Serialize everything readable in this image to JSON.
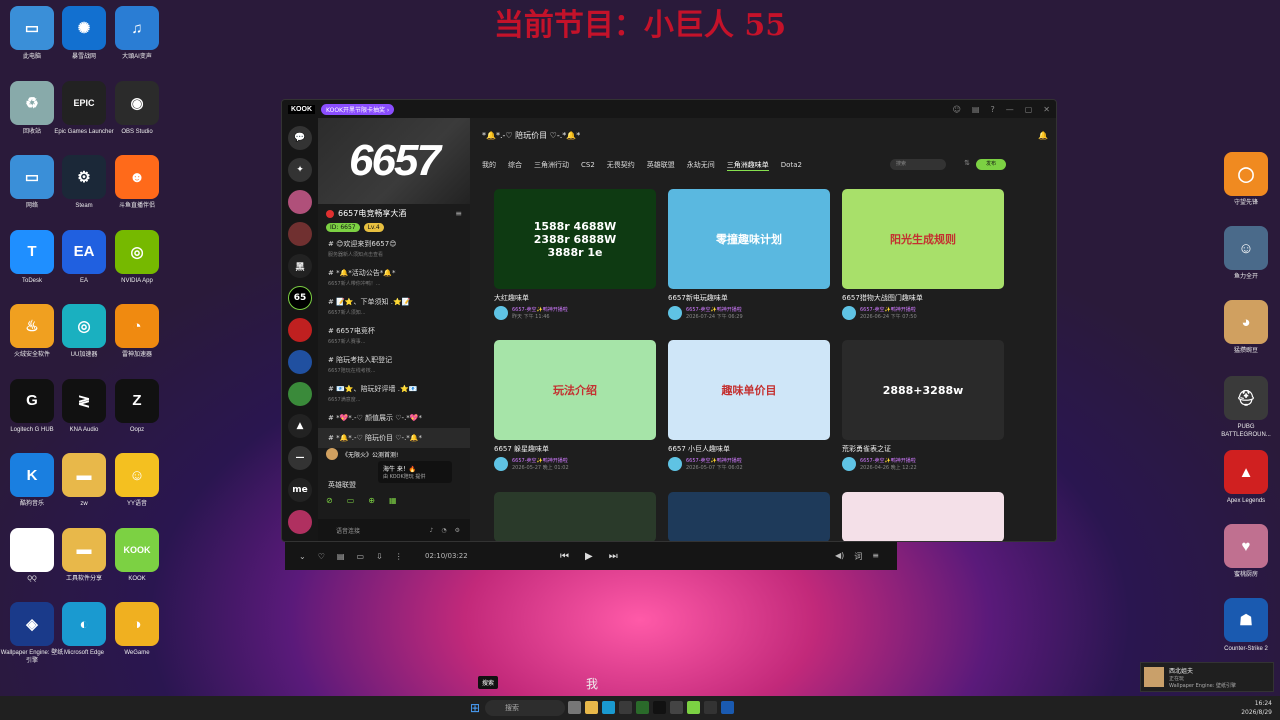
{
  "wallpaper": {
    "title": "当前节目：小巨人 55"
  },
  "desktop_left": [
    {
      "label": "此电脑",
      "icon": "monitor-icon",
      "glyph": "▭",
      "color": "#3a8fd8"
    },
    {
      "label": "暴雪战网",
      "icon": "battlenet-icon",
      "glyph": "✺",
      "color": "#1270d0"
    },
    {
      "label": "大頭AI变声",
      "icon": "voice-changer-icon",
      "glyph": "♫",
      "color": "#2a7dd4"
    },
    {
      "label": "回收站",
      "icon": "recycle-bin-icon",
      "glyph": "♻",
      "color": "#8aa"
    },
    {
      "label": "Epic Games Launcher",
      "icon": "epic-games-icon",
      "glyph": "EPIC",
      "color": "#222"
    },
    {
      "label": "OBS Studio",
      "icon": "obs-icon",
      "glyph": "◉",
      "color": "#2b2b2b"
    },
    {
      "label": "网络",
      "icon": "network-icon",
      "glyph": "▭",
      "color": "#3a8fd8"
    },
    {
      "label": "Steam",
      "icon": "steam-icon",
      "glyph": "⚙",
      "color": "#1b2838"
    },
    {
      "label": "斗鱼直播伴侣",
      "icon": "douyu-icon",
      "glyph": "☻",
      "color": "#ff6a1a"
    },
    {
      "label": "ToDesk",
      "icon": "todesk-icon",
      "glyph": "T",
      "color": "#1f8fff"
    },
    {
      "label": "EA",
      "icon": "ea-icon",
      "glyph": "EA",
      "color": "#2060e0"
    },
    {
      "label": "NVIDIA App",
      "icon": "nvidia-icon",
      "glyph": "◎",
      "color": "#76b900"
    },
    {
      "label": "火绒安全软件",
      "icon": "huorong-icon",
      "glyph": "♨",
      "color": "#f0a020"
    },
    {
      "label": "UU加速器",
      "icon": "uu-icon",
      "glyph": "◎",
      "color": "#1ab0c0"
    },
    {
      "label": "雷神加速器",
      "icon": "leishen-icon",
      "glyph": "◔",
      "color": "#f08a10"
    },
    {
      "label": "Logitech G HUB",
      "icon": "logitech-icon",
      "glyph": "G",
      "color": "#111"
    },
    {
      "label": "KNA Audio",
      "icon": "kna-icon",
      "glyph": "≷",
      "color": "#111"
    },
    {
      "label": "Oopz",
      "icon": "oopz-icon",
      "glyph": "Z",
      "color": "#111"
    },
    {
      "label": "酷狗音乐",
      "icon": "kugou-icon",
      "glyph": "K",
      "color": "#1a7fe0"
    },
    {
      "label": "zw",
      "icon": "folder-icon",
      "glyph": "▬",
      "color": "#e8b84a"
    },
    {
      "label": "YY语音",
      "icon": "yy-icon",
      "glyph": "☺",
      "color": "#f4c020"
    },
    {
      "label": "QQ",
      "icon": "qq-icon",
      "glyph": "☃",
      "color": "#fff"
    },
    {
      "label": "工具软件分享",
      "icon": "folder-icon",
      "glyph": "▬",
      "color": "#e8b84a"
    },
    {
      "label": "KOOK",
      "icon": "kook-icon",
      "glyph": "KOOK",
      "color": "#7cd143"
    },
    {
      "label": "Wallpaper Engine: 壁纸引擎",
      "icon": "wallpaper-engine-icon",
      "glyph": "◈",
      "color": "#1a3a8a"
    },
    {
      "label": "Microsoft Edge",
      "icon": "edge-icon",
      "glyph": "◐",
      "color": "#1a9ad0"
    },
    {
      "label": "WeGame",
      "icon": "wegame-icon",
      "glyph": "◑",
      "color": "#f0b020"
    }
  ],
  "desktop_right": [
    {
      "label": "守望先锋",
      "icon": "overwatch-icon",
      "glyph": "◯",
      "color": "#f08a20"
    },
    {
      "label": "鱼力全开",
      "icon": "game-icon",
      "glyph": "☺",
      "color": "#4a6a8a"
    },
    {
      "label": "猛攒豌豆",
      "icon": "game-icon",
      "glyph": "◕",
      "color": "#d0a060"
    },
    {
      "label": "PUBG BATTLEGROUN...",
      "icon": "pubg-icon",
      "glyph": "⛑",
      "color": "#3a3a3a"
    },
    {
      "label": "Apex Legends",
      "icon": "apex-icon",
      "glyph": "▲",
      "color": "#d02020"
    },
    {
      "label": "蜜桃厨房",
      "icon": "game-icon",
      "glyph": "♥",
      "color": "#c07090"
    },
    {
      "label": "Counter-Strike 2",
      "icon": "cs2-icon",
      "glyph": "☗",
      "color": "#1a5ab0"
    }
  ],
  "kook": {
    "logo": "KOOK",
    "badge": "KOOK开黑节限卡抽奖 ›",
    "server_banner": "6657",
    "server_name": "6657电竞畅享大酒",
    "tags": [
      "ID: 6657",
      "Lv.4"
    ],
    "channels": [
      {
        "name": "😊欢迎来到6657😊",
        "desc": "服务器新人须知点击查看"
      },
      {
        "name": "*🔔*活动公告*🔔*",
        "desc": "6657新人带你冲鸭！..."
      },
      {
        "name": "📝⭐、下单须知 .⭐📝",
        "desc": "6657新人须知..."
      },
      {
        "name": "6657电竞杯",
        "desc": "6657新人赛事..."
      },
      {
        "name": "陪玩考核入职登记",
        "desc": "6657陪玩在线考核..."
      },
      {
        "name": "📧⭐、陪玩好评墙 .⭐📧",
        "desc": "6657满意度..."
      },
      {
        "name": "*💖*.-♡ 颜值展示 ♡-.*💖*",
        "desc": ""
      },
      {
        "name": "*🔔*.-♡ 陪玩价目 ♡-.*🔔*",
        "desc": ""
      }
    ],
    "voice_user": "《无限火》公测首测!",
    "voice_channel": "英雄联盟",
    "sidebar_bottom": "语音连接",
    "channel_title": "*🔔*.-♡ 陪玩价目 ♡-.*🔔*",
    "tabs": [
      "我的",
      "综合",
      "三角洲行动",
      "CS2",
      "无畏契约",
      "英雄联盟",
      "永劫无间",
      "三角洲趣味单",
      "Dota2"
    ],
    "active_tab": "三角洲趣味单",
    "search_placeholder": "搜索",
    "new_button": "发布",
    "cards": [
      {
        "title": "大红趣味单",
        "author": "6657-卖空✨鸭神开播啦",
        "date": "昨天 下午 11:46",
        "thumb": "1588r 4688W\n2388r 6888W\n3888r 1e",
        "bg": "#0e3a12"
      },
      {
        "title": "6657新电玩趣味单",
        "author": "6657-卖空✨鸭神开播啦",
        "date": "2026-07-24 下午 06:29",
        "thumb": "零撞趣味计划",
        "bg": "#5ab8e0"
      },
      {
        "title": "6657猎物大战图门趣味单",
        "author": "6657-卖空✨鸭神开播啦",
        "date": "2026-06-24 下午 07:50",
        "thumb": "阳光生成规则",
        "bg": "#a8e06a"
      },
      {
        "title": "6657 躲星趣味单",
        "author": "6657-卖空✨鸭神开播啦",
        "date": "2026-05-27 晚上 01:02",
        "thumb": "玩法介绍",
        "bg": "#a6e4a8"
      },
      {
        "title": "6657 小巨人趣味单",
        "author": "6657-卖空✨鸭神开播啦",
        "date": "2026-05-07 下午 06:02",
        "thumb": "趣味单价目",
        "bg": "#cfe6f8"
      },
      {
        "title": "荒彩勇雀表之证",
        "author": "6657-卖空✨鸭神开播啦",
        "date": "2026-04-26 晚上 12:22",
        "thumb": "2888+3288w",
        "bg": "#2a2a2a"
      }
    ],
    "tooltip_title": "海牛 来！🔥",
    "tooltip_sub": "由 KOOK陪玩 提供"
  },
  "player": {
    "time": "02:10/03:22"
  },
  "notification": {
    "title": "西北姐夫",
    "line2": "正在玩",
    "line3": "Wallpaper Engine: 壁纸引擎"
  },
  "taskbar": {
    "search": "搜索",
    "time": "16:24",
    "date": "2026/8/29"
  },
  "misc": {
    "chip": "搜索",
    "wo": "我"
  }
}
